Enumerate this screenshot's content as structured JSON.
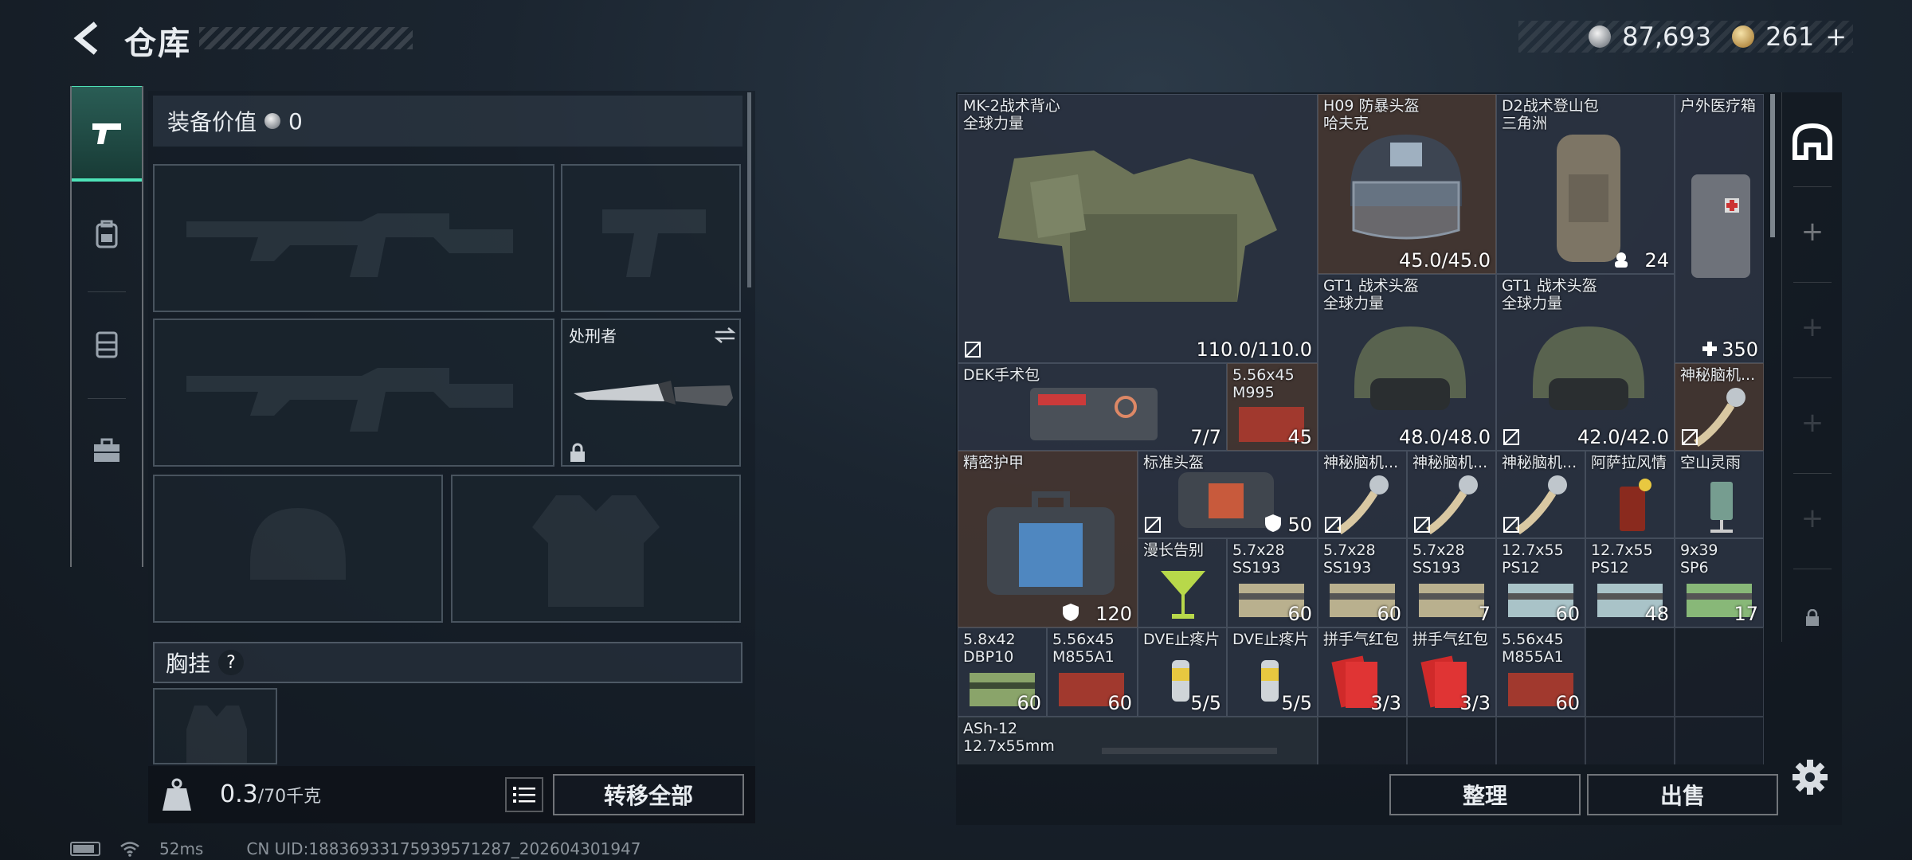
{
  "header": {
    "title": "仓库",
    "currency_silver": "87,693",
    "currency_gold": "261",
    "gold_plus": "+"
  },
  "left_nav": {
    "items": [
      "pistol-icon",
      "backpack-icon",
      "rig-icon",
      "toolbox-icon"
    ]
  },
  "equipment": {
    "value_label": "装备价值",
    "value": "0",
    "knife_name": "处刑者",
    "chest_label": "胸挂",
    "chest_help": "?"
  },
  "weight": {
    "current": "0.3",
    "capacity": "/70千克"
  },
  "buttons": {
    "transfer_all": "转移全部",
    "sort": "整理",
    "sell": "出售"
  },
  "footer": {
    "ping": "52ms",
    "uid": "CN UID:1883693317593957128​7_202604301947"
  },
  "stash_items": [
    {
      "name": "MK-2战术背心\n全球力量",
      "value": "110.0/110.0"
    },
    {
      "name": "H09 防暴头盔\n哈夫克",
      "value": "45.0/45.0"
    },
    {
      "name": "D2战术登山包\n三角洲",
      "value": "24"
    },
    {
      "name": "户外医疗箱",
      "value": "350"
    },
    {
      "name": "GT1 战术头盔\n全球力量",
      "value": "48.0/48.0"
    },
    {
      "name": "GT1 战术头盔\n全球力量",
      "value": "42.0/42.0"
    },
    {
      "name": "DEK手术包",
      "value": "7/7"
    },
    {
      "name": "5.56x45\nM995",
      "value": "45"
    },
    {
      "name": "神秘脑机...",
      "value": ""
    },
    {
      "name": "精密护甲",
      "value": "120"
    },
    {
      "name": "标准头盔",
      "value": "50"
    },
    {
      "name": "神秘脑机...",
      "value": ""
    },
    {
      "name": "神秘脑机...",
      "value": ""
    },
    {
      "name": "神秘脑机...",
      "value": ""
    },
    {
      "name": "阿萨拉风情",
      "value": ""
    },
    {
      "name": "空山灵雨",
      "value": ""
    },
    {
      "name": "漫长告别",
      "value": ""
    },
    {
      "name": "5.7x28\nSS193",
      "value": "60"
    },
    {
      "name": "5.7x28\nSS193",
      "value": "60"
    },
    {
      "name": "5.7x28\nSS193",
      "value": "7"
    },
    {
      "name": "12.7x55\nPS12",
      "value": "60"
    },
    {
      "name": "12.7x55\nPS12",
      "value": "48"
    },
    {
      "name": "9x39\nSP6",
      "value": "17"
    },
    {
      "name": "5.8x42\nDBP10",
      "value": "60"
    },
    {
      "name": "5.56x45\nM855A1",
      "value": "60"
    },
    {
      "name": "DVE止疼片",
      "value": "5/5"
    },
    {
      "name": "DVE止疼片",
      "value": "5/5"
    },
    {
      "name": "拼手气红包",
      "value": "3/3"
    },
    {
      "name": "拼手气红包",
      "value": "3/3"
    },
    {
      "name": "5.56x45\nM855A1",
      "value": "60"
    },
    {
      "name": "ASh-12\n12.7x55mm",
      "value": ""
    }
  ],
  "colors": {
    "accent": "#4ee3b8",
    "rarity_blue": "#303848",
    "rarity_brown": "#503e36",
    "rarity_gray": "#2c343e"
  }
}
